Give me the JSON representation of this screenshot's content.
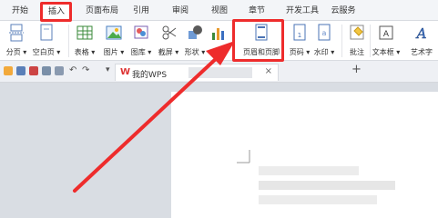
{
  "menu": {
    "tabs": [
      "开始",
      "插入",
      "页面布局",
      "引用",
      "审阅",
      "视图",
      "章节",
      "开发工具",
      "云服务"
    ],
    "active": "插入"
  },
  "ribbon": {
    "tools": [
      {
        "label": "分页",
        "icon": "page-break-icon"
      },
      {
        "label": "空白页",
        "icon": "blank-page-icon"
      },
      {
        "label": "表格",
        "icon": "table-icon"
      },
      {
        "label": "图片",
        "icon": "picture-icon"
      },
      {
        "label": "图库",
        "icon": "gallery-icon"
      },
      {
        "label": "截屏",
        "icon": "screenshot-icon"
      },
      {
        "label": "形状",
        "icon": "shape-icon"
      },
      {
        "label": "图表",
        "icon": "chart-icon"
      },
      {
        "label": "页眉和页脚",
        "icon": "header-footer-icon"
      },
      {
        "label": "页码",
        "icon": "page-number-icon"
      },
      {
        "label": "水印",
        "icon": "watermark-icon"
      },
      {
        "label": "批注",
        "icon": "comment-icon"
      },
      {
        "label": "文本框",
        "icon": "textbox-icon"
      },
      {
        "label": "艺术字",
        "icon": "wordart-icon"
      }
    ]
  },
  "doc_tabs": {
    "home": "我的WPS",
    "close": "×",
    "add": "+",
    "nav": "▾"
  },
  "annotation": {
    "color": "#ee2c2c"
  }
}
